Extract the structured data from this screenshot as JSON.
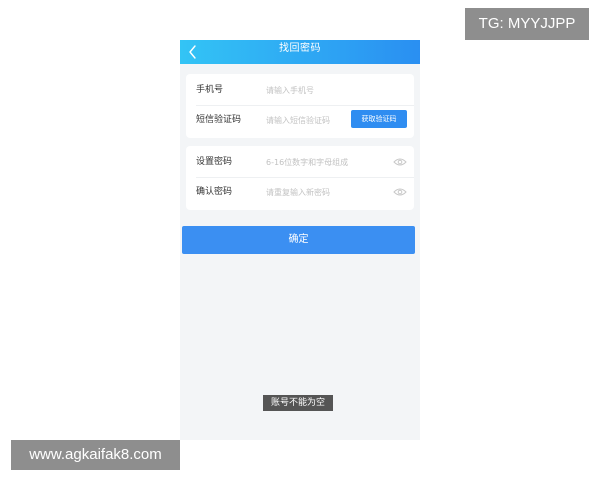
{
  "watermarks": {
    "top": "TG: MYYJJPP",
    "bottom": "www.agkaifak8.com"
  },
  "header": {
    "title": "找回密码",
    "back_icon": "chevron-left-icon"
  },
  "form": {
    "phone": {
      "label": "手机号",
      "placeholder": "请输入手机号"
    },
    "sms_code": {
      "label": "短信验证码",
      "placeholder": "请输入短信验证码",
      "button_label": "获取验证码"
    },
    "password": {
      "label": "设置密码",
      "placeholder": "6-16位数字和字母组成",
      "icon": "eye-icon"
    },
    "confirm_password": {
      "label": "确认密码",
      "placeholder": "请重复输入新密码",
      "icon": "eye-icon"
    }
  },
  "confirm_button_label": "确定",
  "toast_message": "账号不能为空",
  "colors": {
    "header_start": "#33c4f5",
    "header_end": "#2a8ff2",
    "primary_button": "#3b8ff2",
    "background": "#f3f5f7"
  }
}
